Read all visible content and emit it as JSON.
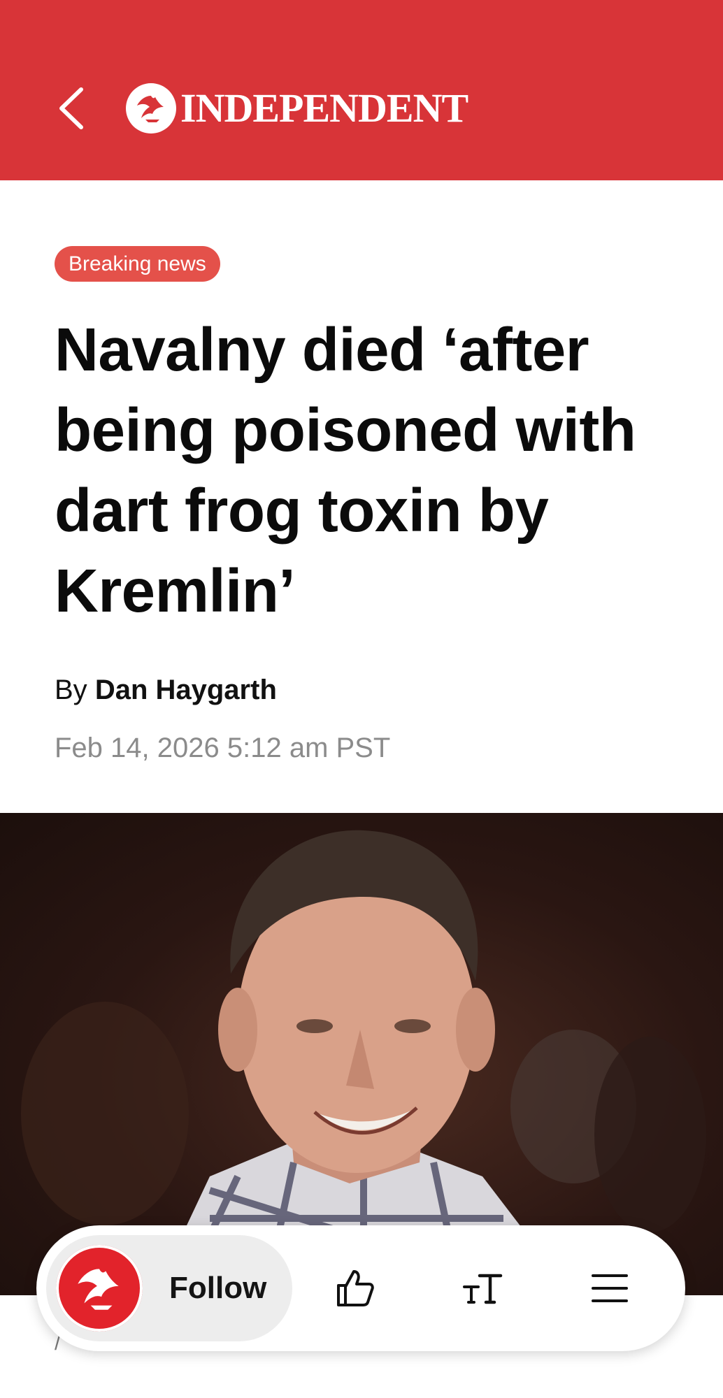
{
  "header": {
    "back_icon": "back-chevron-icon",
    "brand_logo": "independent-eagle-logo",
    "brand_name": "INDEPENDENT",
    "background_color": "#d83438"
  },
  "article": {
    "badge": "Breaking news",
    "badge_color": "#e4514a",
    "headline": "Navalny died ‘after being poisoned with dart frog toxin by Kremlin’",
    "byline_prefix": "By",
    "author": "Dan Haygarth",
    "dateline": "Feb 14, 2026 5:12 am PST"
  },
  "hero_image": {
    "subject": "smiling man in checked shirt"
  },
  "partial_caption": "/",
  "action_bar": {
    "follow_logo": "independent-eagle-logo",
    "follow_label": "Follow",
    "like_icon": "thumbs-up-icon",
    "text_size_icon": "text-size-icon",
    "menu_icon": "hamburger-menu-icon"
  }
}
